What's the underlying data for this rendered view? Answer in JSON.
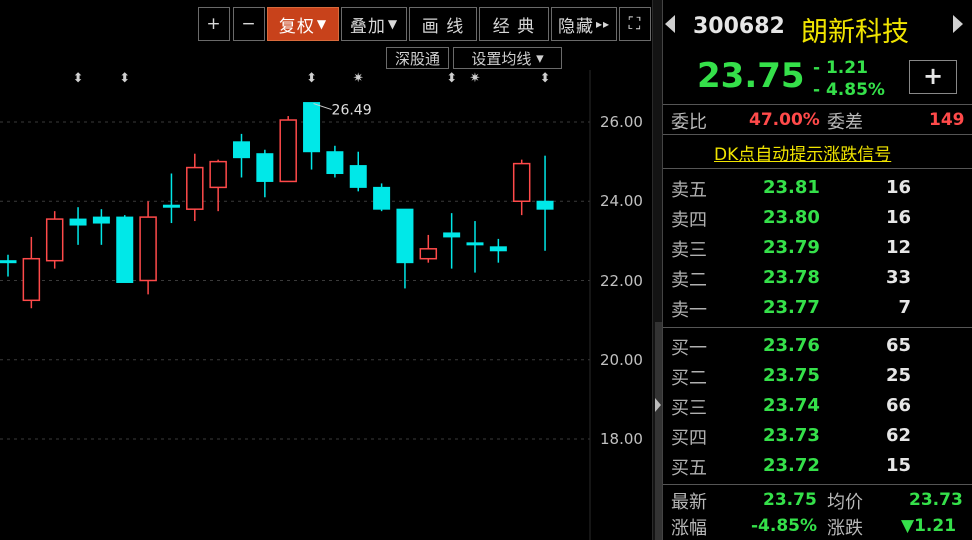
{
  "toolbar": {
    "plus": "+",
    "minus": "−",
    "fuquan": "复权",
    "fuquan_arrow": "▼",
    "diejia": "叠加",
    "diejia_arrow": "▼",
    "huaxian": "画 线",
    "jingdian": "经 典",
    "yincang": "隐藏",
    "yincang_arrow": "▸▸",
    "fullscreen": "⛶"
  },
  "subtoolbar": {
    "shengutong": "深股通",
    "shezhi": "设置均线",
    "shezhi_arrow": "▾"
  },
  "chart_data": {
    "type": "candlestick",
    "ylim": [
      16.4,
      26.9
    ],
    "yticks": [
      "26.00",
      "24.00",
      "22.00",
      "20.00",
      "18.00"
    ],
    "ytick_values": [
      26.0,
      24.0,
      22.0,
      20.0,
      18.0
    ],
    "annotation": "26.49",
    "up_color": "#ff4a4a",
    "down_color": "#00e8e8",
    "candles": [
      {
        "o": 22.5,
        "h": 22.65,
        "l": 22.1,
        "c": 22.5,
        "dir": "down",
        "mark": ""
      },
      {
        "o": 21.5,
        "h": 23.1,
        "l": 21.3,
        "c": 22.55,
        "dir": "up",
        "mark": ""
      },
      {
        "o": 22.5,
        "h": 23.75,
        "l": 22.3,
        "c": 23.55,
        "dir": "up",
        "mark": ""
      },
      {
        "o": 23.55,
        "h": 23.85,
        "l": 22.9,
        "c": 23.4,
        "dir": "down",
        "mark": "⬍"
      },
      {
        "o": 23.6,
        "h": 23.8,
        "l": 22.9,
        "c": 23.45,
        "dir": "down",
        "mark": ""
      },
      {
        "o": 23.6,
        "h": 23.65,
        "l": 21.95,
        "c": 21.95,
        "dir": "down",
        "mark": "⬍"
      },
      {
        "o": 22.0,
        "h": 24.0,
        "l": 21.65,
        "c": 23.6,
        "dir": "up",
        "mark": ""
      },
      {
        "o": 23.9,
        "h": 24.7,
        "l": 23.45,
        "c": 23.85,
        "dir": "down",
        "mark": ""
      },
      {
        "o": 23.8,
        "h": 25.2,
        "l": 23.5,
        "c": 24.85,
        "dir": "up",
        "mark": ""
      },
      {
        "o": 24.35,
        "h": 25.05,
        "l": 23.75,
        "c": 25.0,
        "dir": "up",
        "mark": ""
      },
      {
        "o": 25.5,
        "h": 25.7,
        "l": 24.6,
        "c": 25.1,
        "dir": "down",
        "mark": ""
      },
      {
        "o": 25.2,
        "h": 25.3,
        "l": 24.1,
        "c": 24.5,
        "dir": "down",
        "mark": ""
      },
      {
        "o": 24.5,
        "h": 26.15,
        "l": 24.5,
        "c": 26.05,
        "dir": "up",
        "mark": ""
      },
      {
        "o": 26.49,
        "h": 26.49,
        "l": 24.8,
        "c": 25.25,
        "dir": "down",
        "mark": "⬍"
      },
      {
        "o": 25.25,
        "h": 25.4,
        "l": 24.6,
        "c": 24.7,
        "dir": "down",
        "mark": ""
      },
      {
        "o": 24.9,
        "h": 25.25,
        "l": 24.25,
        "c": 24.35,
        "dir": "down",
        "mark": "✷"
      },
      {
        "o": 24.35,
        "h": 24.45,
        "l": 23.75,
        "c": 23.8,
        "dir": "down",
        "mark": ""
      },
      {
        "o": 23.8,
        "h": 23.8,
        "l": 21.8,
        "c": 22.45,
        "dir": "down",
        "mark": ""
      },
      {
        "o": 22.55,
        "h": 23.15,
        "l": 22.45,
        "c": 22.8,
        "dir": "up",
        "mark": ""
      },
      {
        "o": 23.2,
        "h": 23.7,
        "l": 22.3,
        "c": 23.1,
        "dir": "down",
        "mark": "⬍"
      },
      {
        "o": 22.95,
        "h": 23.5,
        "l": 22.2,
        "c": 22.9,
        "dir": "down",
        "mark": "✷"
      },
      {
        "o": 22.85,
        "h": 23.05,
        "l": 22.45,
        "c": 22.75,
        "dir": "down",
        "mark": ""
      },
      {
        "o": 24.0,
        "h": 25.05,
        "l": 23.65,
        "c": 24.95,
        "dir": "up",
        "mark": ""
      },
      {
        "o": 24.0,
        "h": 25.15,
        "l": 22.75,
        "c": 23.8,
        "dir": "down",
        "mark": "⬍"
      }
    ]
  },
  "quote": {
    "code": "300682",
    "name": "朗新科技",
    "price": "23.75",
    "change": "- 1.21",
    "change_pct": "- 4.85%",
    "add_label": "+",
    "weibi_label": "委比",
    "weibi_value": "47.00%",
    "weicha_label": "委差",
    "weicha_value": "149",
    "dk_link": "DK点自动提示涨跌信号",
    "asks": [
      {
        "label": "卖五",
        "price": "23.81",
        "vol": "16"
      },
      {
        "label": "卖四",
        "price": "23.80",
        "vol": "16"
      },
      {
        "label": "卖三",
        "price": "23.79",
        "vol": "12"
      },
      {
        "label": "卖二",
        "price": "23.78",
        "vol": "33"
      },
      {
        "label": "卖一",
        "price": "23.77",
        "vol": "7"
      }
    ],
    "bids": [
      {
        "label": "买一",
        "price": "23.76",
        "vol": "65"
      },
      {
        "label": "买二",
        "price": "23.75",
        "vol": "25"
      },
      {
        "label": "买三",
        "price": "23.74",
        "vol": "66"
      },
      {
        "label": "买四",
        "price": "23.73",
        "vol": "62"
      },
      {
        "label": "买五",
        "price": "23.72",
        "vol": "15"
      }
    ],
    "latest_label": "最新",
    "latest_value": "23.75",
    "avg_label": "均价",
    "avg_value": "23.73",
    "zhangfu_label": "涨幅",
    "zhangfu_value": "-4.85%",
    "zhangdie_label": "涨跌",
    "zhangdie_value": "▼1.21"
  }
}
